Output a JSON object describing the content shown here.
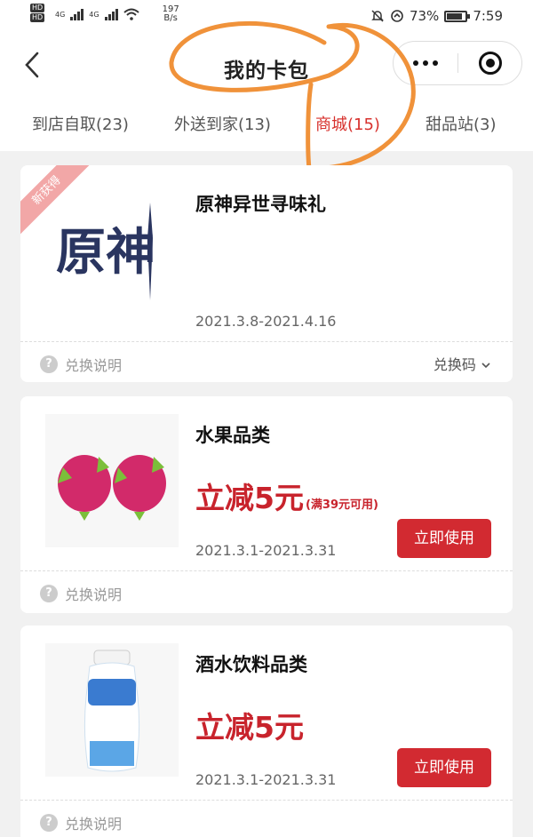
{
  "status_bar": {
    "hd_badges": [
      "HD",
      "HD"
    ],
    "network_type": "4G",
    "net_speed_value": "197",
    "net_speed_unit": "B/s",
    "battery": "73%",
    "time": "7:59"
  },
  "nav": {
    "title": "我的卡包"
  },
  "tabs": [
    {
      "label": "到店自取(23)",
      "active": false
    },
    {
      "label": "外送到家(13)",
      "active": false
    },
    {
      "label": "商城(15)",
      "active": true
    },
    {
      "label": "甜品站(3)",
      "active": false
    }
  ],
  "cards": [
    {
      "badge": "新获得",
      "title": "原神异世寻味礼",
      "logo_text": "原神",
      "date_range": "2021.3.8-2021.4.16",
      "help_label": "兑换说明",
      "code_label": "兑换码"
    },
    {
      "title": "水果品类",
      "discount": "立减5元",
      "condition": "(满39元可用)",
      "date_range": "2021.3.1-2021.3.31",
      "use_button": "立即使用",
      "help_label": "兑换说明"
    },
    {
      "title": "酒水饮料品类",
      "discount": "立减5元",
      "date_range": "2021.3.1-2021.3.31",
      "use_button": "立即使用",
      "help_label": "兑换说明"
    }
  ],
  "colors": {
    "accent": "#d22a31",
    "annotation": "#f0923a"
  }
}
